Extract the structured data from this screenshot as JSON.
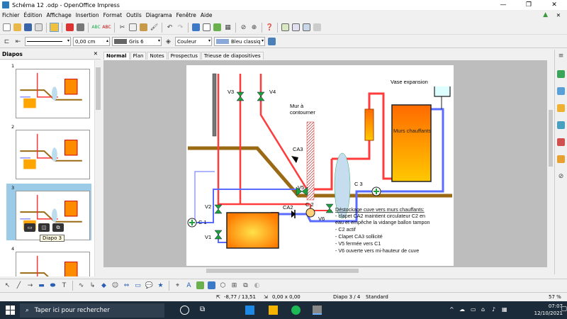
{
  "window": {
    "title": "Schéma 12 .odp - OpenOffice Impress",
    "minimize": "—",
    "maximize": "❐",
    "close": "✕"
  },
  "menu": [
    "Fichier",
    "Édition",
    "Affichage",
    "Insertion",
    "Format",
    "Outils",
    "Diagrama",
    "Fenêtre",
    "Aide"
  ],
  "format_bar": {
    "line_width": "0,00 cm",
    "area_color_label": "Gris 6",
    "fill_type": "Couleur",
    "fill_color": "Bleu classiq"
  },
  "slides_pane": {
    "title": "Diapos",
    "close": "✕",
    "numbers": [
      "1",
      "2",
      "3",
      "4"
    ],
    "tooltip": "Diapo 3"
  },
  "view_tabs": [
    "Normal",
    "Plan",
    "Notes",
    "Prospectus",
    "Trieuse de diapositives"
  ],
  "slide": {
    "labels": {
      "v3": "V3",
      "v4": "V4",
      "mur": "Mur à contourner",
      "vase": "Vase expansion",
      "murs_chauffants": "Murs chauffants",
      "ca3": "CA3",
      "v5": "V5",
      "c3": "C 3",
      "v2": "V2",
      "ca2": "CA2",
      "c2": "C 2",
      "v6": "V6",
      "c1": "C 1",
      "v1": "V1"
    },
    "notes": [
      "Déstockage cuve vers murs chauffants:",
      "- clapet CA2 maintient circulateur C2 en eau et empêche la vidange ballon tampon",
      "- C2 actif",
      "- Clapet CA3 sollicité",
      "- V5 fermée vers C1",
      "- V6 ouverte vers mi-hauteur de cuve"
    ]
  },
  "status": {
    "position": "-8,77 / 13,51",
    "size": "0,00 x 0,00",
    "page": "Diapo 3 / 4",
    "layout": "Standard",
    "zoom": "57 %"
  },
  "taskbar": {
    "search_placeholder": "Taper ici pour rechercher",
    "time": "07:07",
    "date": "12/10/2021"
  },
  "colors": {
    "pipe_red": "#ff3b3b",
    "pipe_blue": "#5a6cff",
    "pipe_brown": "#9a6a14",
    "valve": "#1fa03a",
    "tank_orange": "#ff8c00",
    "tank_yellow": "#ffd800"
  }
}
